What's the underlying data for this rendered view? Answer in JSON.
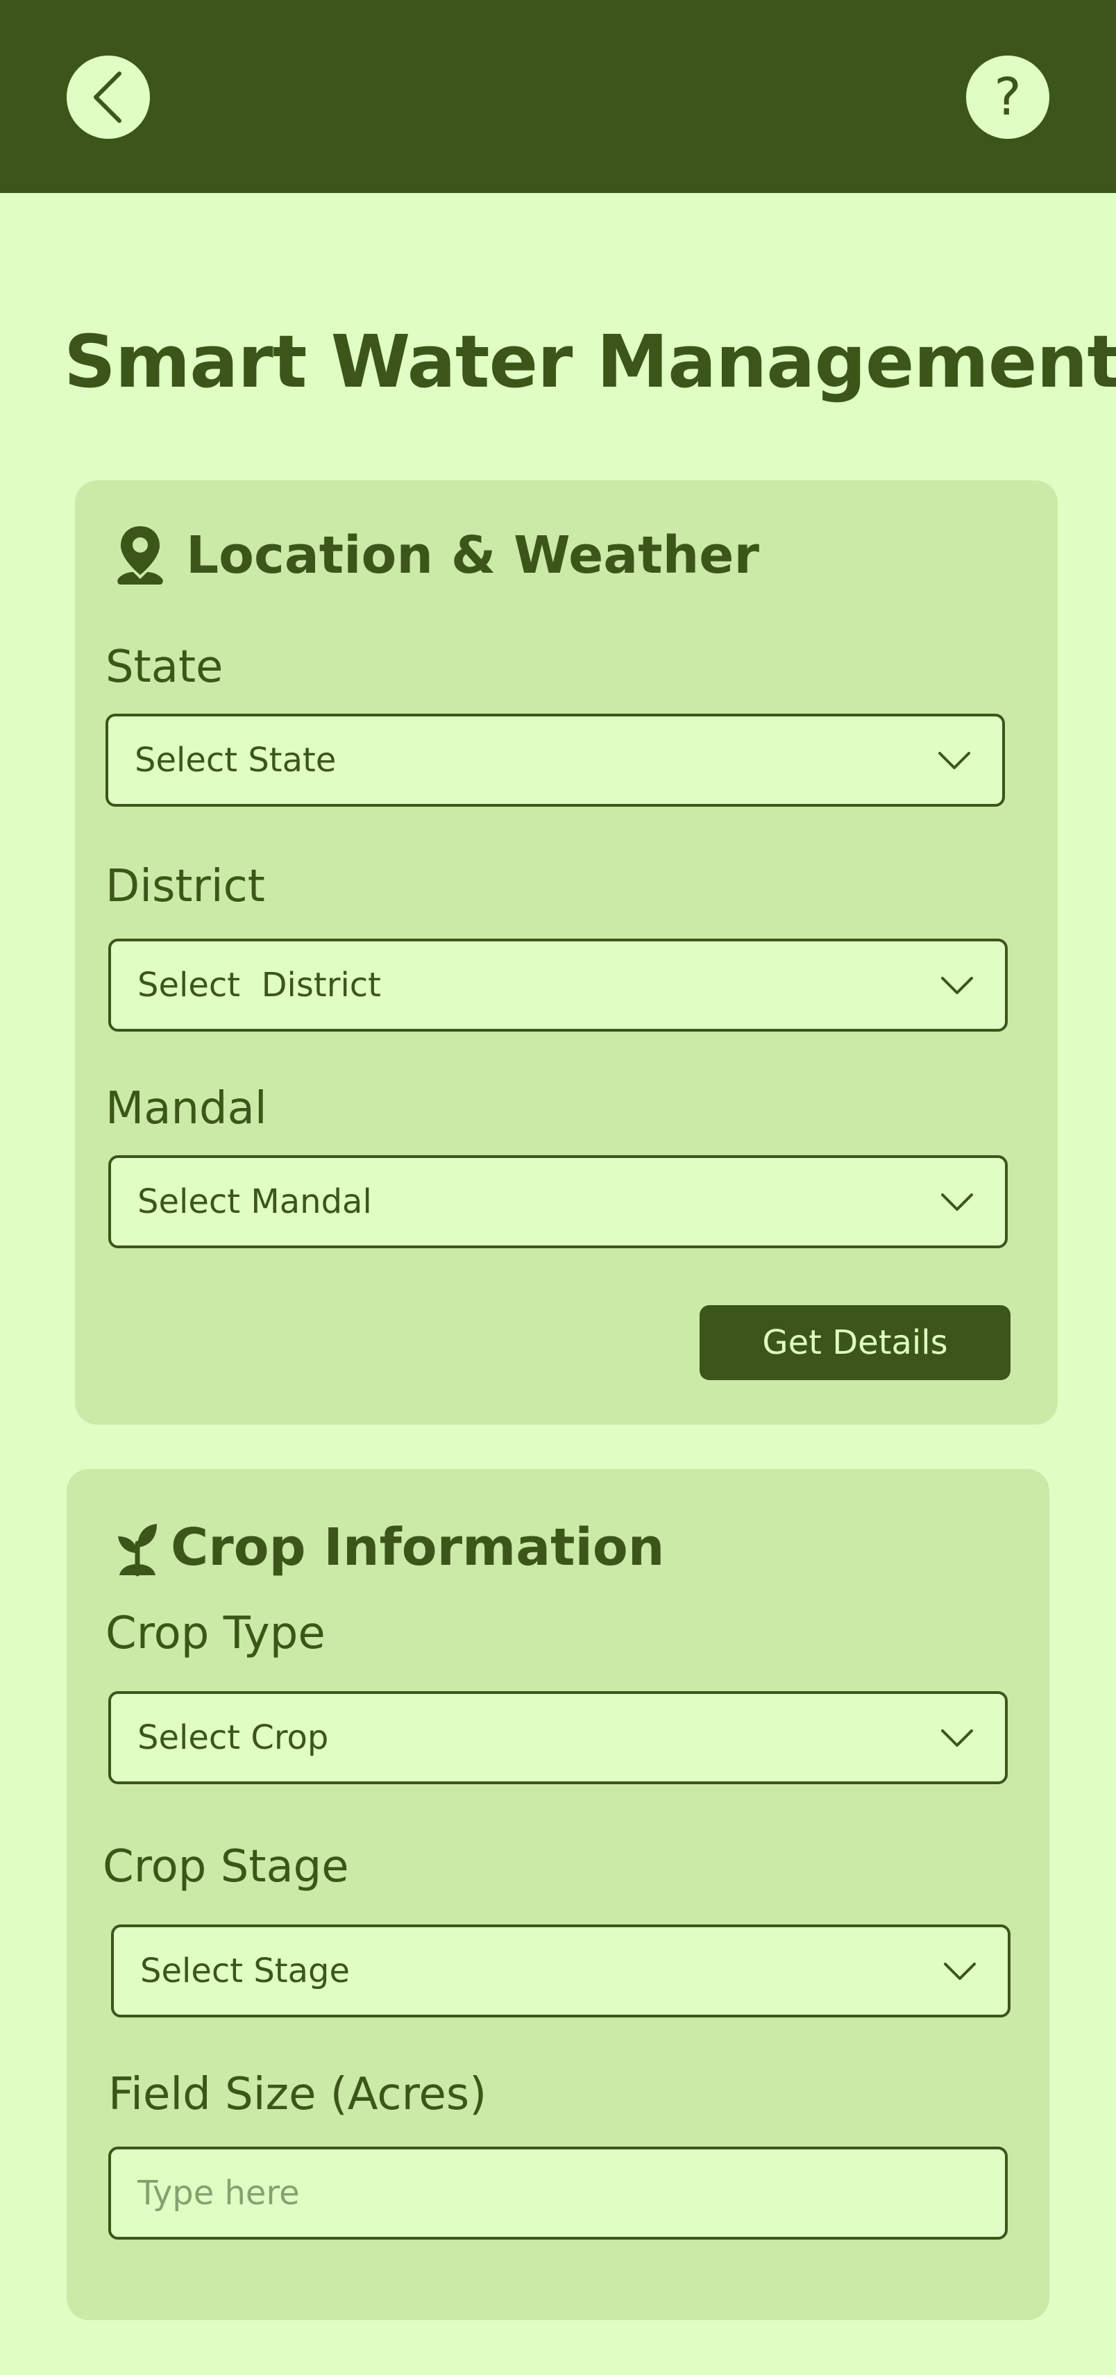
{
  "page": {
    "title": "Smart Water Management"
  },
  "colors": {
    "primary": "#3c561a",
    "background": "#e0fdc3",
    "card": "#cbe9a7"
  },
  "header": {
    "back_icon": "chevron-left-icon",
    "help_icon": "help-icon",
    "help_glyph": "?"
  },
  "location_card": {
    "title": "Location & Weather",
    "icon": "location-pin-icon",
    "state": {
      "label": "State",
      "value": "Select State"
    },
    "district": {
      "label": "District",
      "value": "Select  District"
    },
    "mandal": {
      "label": "Mandal",
      "value": "Select Mandal"
    },
    "button_label": "Get Details"
  },
  "crop_card": {
    "title": "Crop Information",
    "icon": "sprout-icon",
    "crop_type": {
      "label": "Crop Type",
      "value": "Select Crop"
    },
    "crop_stage": {
      "label": "Crop Stage",
      "value": "Select Stage"
    },
    "field_size": {
      "label": "Field Size (Acres)",
      "placeholder": "Type here"
    }
  }
}
